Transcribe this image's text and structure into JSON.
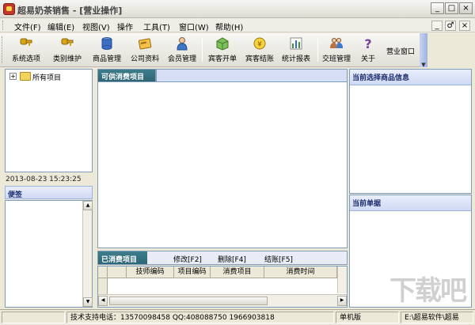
{
  "window": {
    "title": "超易奶茶销售 - [营业操作]",
    "min_label": "_",
    "max_label": "□",
    "close_label": "×"
  },
  "menu": [
    {
      "label": "文件(F)"
    },
    {
      "label": "编辑(E)"
    },
    {
      "label": "视图(V)"
    },
    {
      "label": "操作"
    },
    {
      "label": "工具(T)"
    },
    {
      "label": "窗口(W)"
    },
    {
      "label": "帮助(H)"
    }
  ],
  "mdi_buttons": [
    "_",
    "♂",
    "×"
  ],
  "toolbar": [
    {
      "label": "系统选项",
      "icon": "key-icon",
      "color": "#d9a419"
    },
    {
      "label": "类别维护",
      "icon": "key-icon",
      "color": "#d9a419"
    },
    {
      "label": "商品管理",
      "icon": "database-icon",
      "color": "#3b6fc4"
    },
    {
      "label": "公司资料",
      "icon": "card-icon",
      "color": "#e0a020"
    },
    {
      "label": "会员管理",
      "icon": "person-icon",
      "color": "#3d78c8"
    },
    {
      "label": "宾客开单",
      "icon": "box-icon",
      "color": "#5aa03a"
    },
    {
      "label": "宾客结账",
      "icon": "coin-icon",
      "color": "#e8b81c"
    },
    {
      "label": "统计报表",
      "icon": "chart-icon",
      "color": "#3f8f3f"
    },
    {
      "label": "交班管理",
      "icon": "people-icon",
      "color": "#c0703a"
    },
    {
      "label": "关于",
      "icon": "question-icon",
      "color": "#7b3fa0"
    },
    {
      "label": "营业窗口",
      "icon": "",
      "color": ""
    }
  ],
  "tree": {
    "root_label": "所有项目",
    "expander": "+"
  },
  "datetime": "2013-08-23 15:23:25",
  "memo": {
    "label": "便签"
  },
  "center": {
    "tab_label": "可供消费项目"
  },
  "right": {
    "info_label": "当前选择商品信息",
    "bill_label": "当前单据"
  },
  "consumed": {
    "tab_label": "已消费项目",
    "modify_label": "修改[F2]",
    "delete_label": "删除[F4]",
    "checkout_label": "结账[F5]",
    "columns": [
      "技师编码",
      "项目编码",
      "消费项目",
      "消费时间"
    ]
  },
  "status": {
    "support": "技术支持电话：13570098458 QQ:408088750 1966903818",
    "edition": "单机版",
    "vendor": "E:\\超易软件\\超易"
  },
  "watermark": "下载吧"
}
